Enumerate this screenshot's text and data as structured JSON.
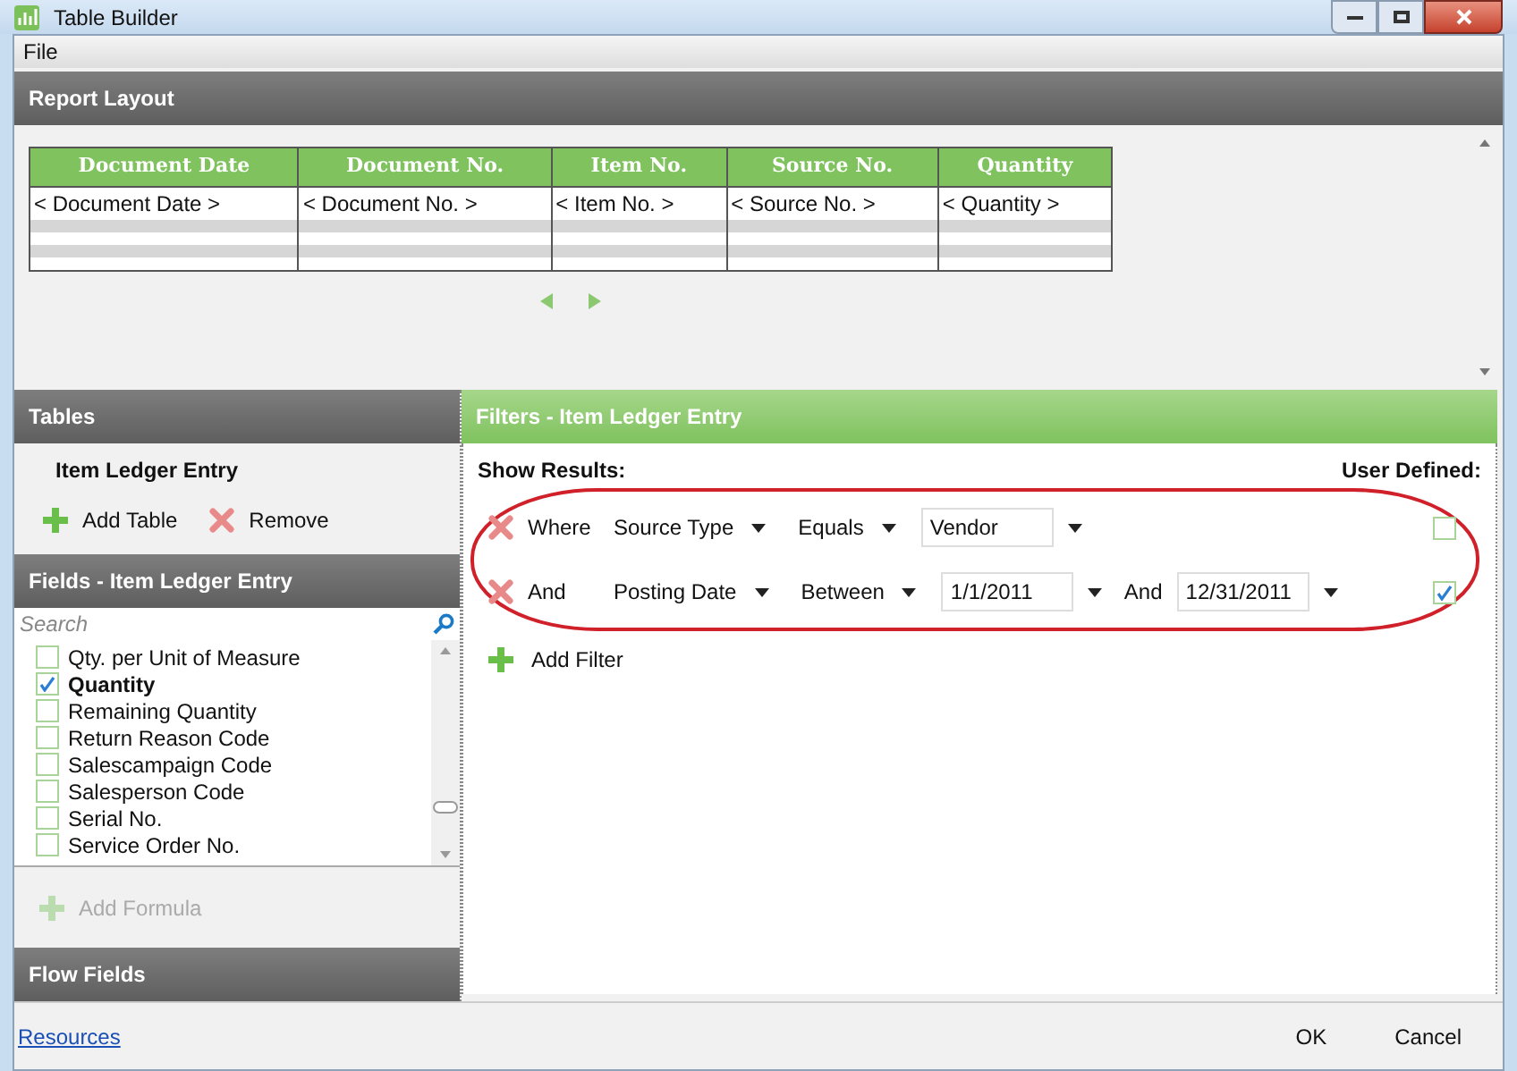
{
  "window": {
    "title": "Table Builder"
  },
  "menu": [
    "File"
  ],
  "report_layout": {
    "title": "Report Layout",
    "columns": [
      {
        "heading": "Document Date",
        "cell": "< Document Date >"
      },
      {
        "heading": "Document No.",
        "cell": "< Document No. >"
      },
      {
        "heading": "Item No.",
        "cell": "< Item No. >"
      },
      {
        "heading": "Source No.",
        "cell": "< Source No. >"
      },
      {
        "heading": "Quantity",
        "cell": "< Quantity >"
      }
    ]
  },
  "tables": {
    "title": "Tables",
    "items": [
      "Item Ledger Entry"
    ],
    "actions": [
      {
        "kind": "add",
        "label": "Add Table"
      },
      {
        "kind": "remove",
        "label": "Remove"
      }
    ]
  },
  "fields": {
    "title": "Fields - Item Ledger Entry",
    "search": {
      "placeholder": "Search"
    },
    "items": [
      {
        "label": "Qty. per Unit of Measure",
        "checked": false
      },
      {
        "label": "Quantity",
        "checked": true
      },
      {
        "label": "Remaining Quantity",
        "checked": false
      },
      {
        "label": "Return Reason Code",
        "checked": false
      },
      {
        "label": "Salescampaign Code",
        "checked": false
      },
      {
        "label": "Salesperson Code",
        "checked": false
      },
      {
        "label": "Serial No.",
        "checked": false
      },
      {
        "label": "Service Order No.",
        "checked": false
      }
    ],
    "add_formula": {
      "label": "Add Formula",
      "disabled": true
    }
  },
  "flow_fields": {
    "title": "Flow Fields"
  },
  "filters": {
    "title": "Filters - Item Ledger Entry",
    "show_results": "Show Results:",
    "user_defined": "User Defined:",
    "rows": [
      {
        "connector": "Where",
        "field": "Source Type",
        "operator": "Equals",
        "value": "Vendor",
        "user_defined": false
      },
      {
        "connector": "And",
        "field": "Posting Date",
        "operator": "Between",
        "value": "1/1/2011",
        "second_connector": "And",
        "second_value": "12/31/2011",
        "user_defined": true
      }
    ],
    "add_filter": "Add Filter"
  },
  "footer": {
    "link": "Resources",
    "buttons": [
      "OK",
      "Cancel"
    ]
  }
}
